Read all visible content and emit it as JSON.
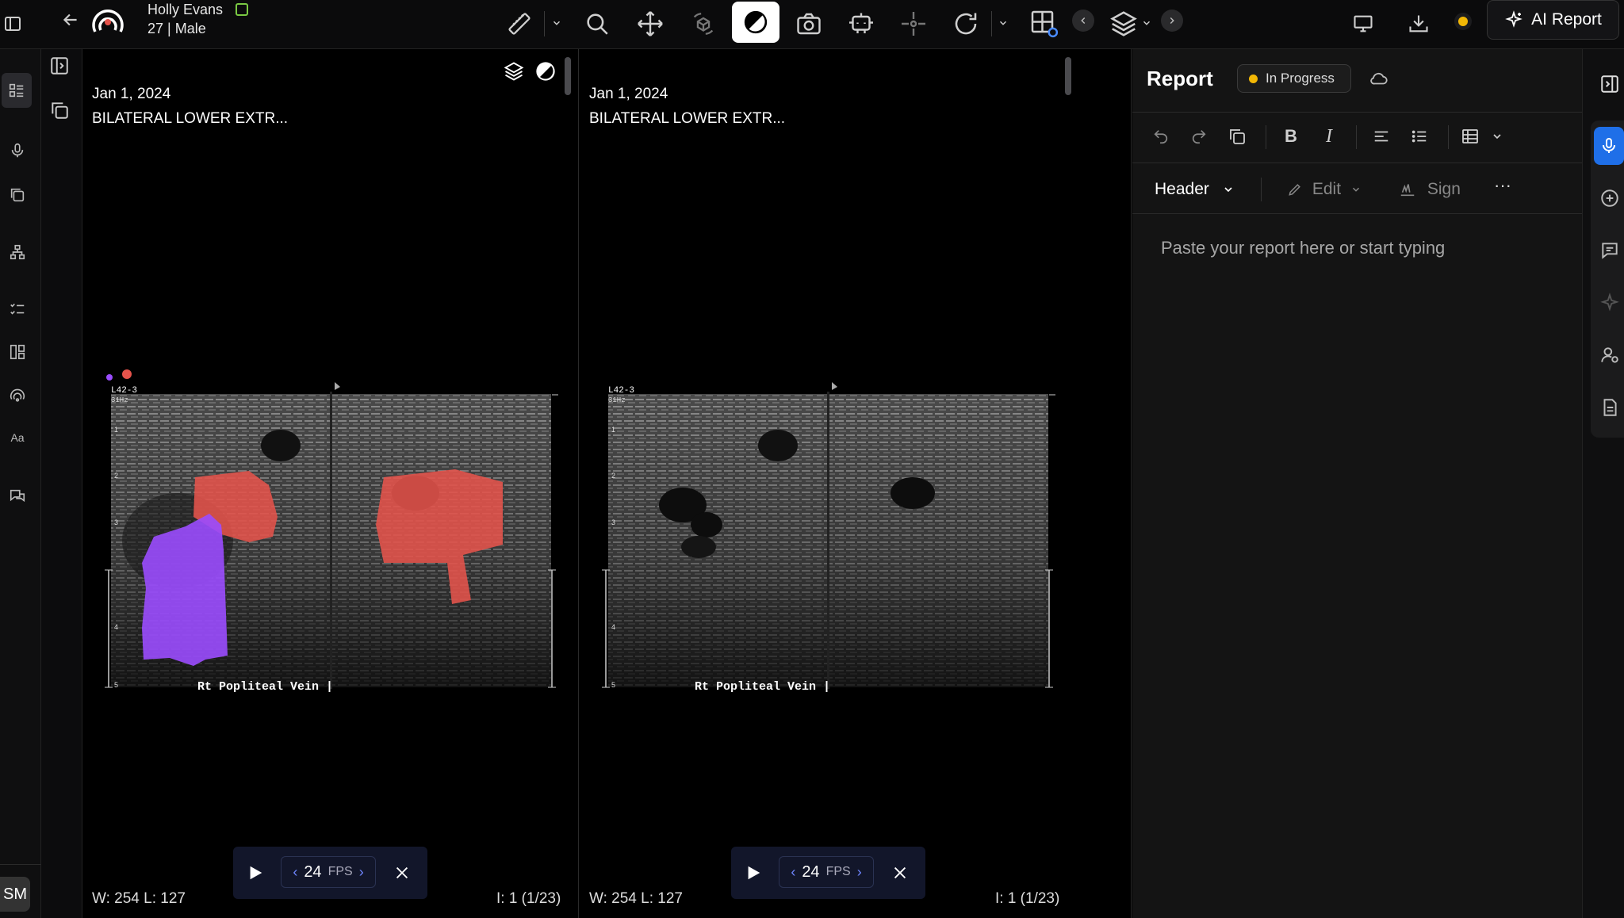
{
  "patient": {
    "name": "Holly Evans",
    "meta": "27 | Male"
  },
  "toolbar": {
    "ai_report_label": "AI Report",
    "tools": [
      "ruler-icon",
      "search-icon",
      "move-icon",
      "rotate3d-icon",
      "contrast-icon",
      "camera-icon",
      "robot-icon",
      "crosshair-icon",
      "rotate-icon",
      "grid-settings-icon",
      "layers-icon"
    ]
  },
  "viewports": [
    {
      "date": "Jan 1, 2024",
      "study": "BILATERAL LOWER EXTR...",
      "wl": "W: 254   L: 127",
      "index": "I: 1 (1/23)",
      "fps": "24",
      "fps_unit": "FPS",
      "probe": "L42-3",
      "freq": "31Hz",
      "label": "Rt Popliteal Vein |",
      "depths": [
        "1",
        "2",
        "3",
        "4",
        "5"
      ]
    },
    {
      "date": "Jan 1, 2024",
      "study": "BILATERAL LOWER EXTR...",
      "wl": "W: 254   L: 127",
      "index": "I: 1 (1/23)",
      "fps": "24",
      "fps_unit": "FPS",
      "probe": "L42-3",
      "freq": "31Hz",
      "label": "Rt Popliteal Vein |",
      "depths": [
        "1",
        "2",
        "3",
        "4",
        "5"
      ]
    }
  ],
  "report": {
    "title": "Report",
    "status": "In Progress",
    "header_label": "Header",
    "edit_label": "Edit",
    "sign_label": "Sign",
    "placeholder": "Paste your report here or start typing"
  },
  "user": {
    "initials": "SM"
  },
  "colors": {
    "accent": "#1f6fe8",
    "status": "#f2b705",
    "segment_red": "#e5534b",
    "segment_purple": "#9b4dff"
  }
}
